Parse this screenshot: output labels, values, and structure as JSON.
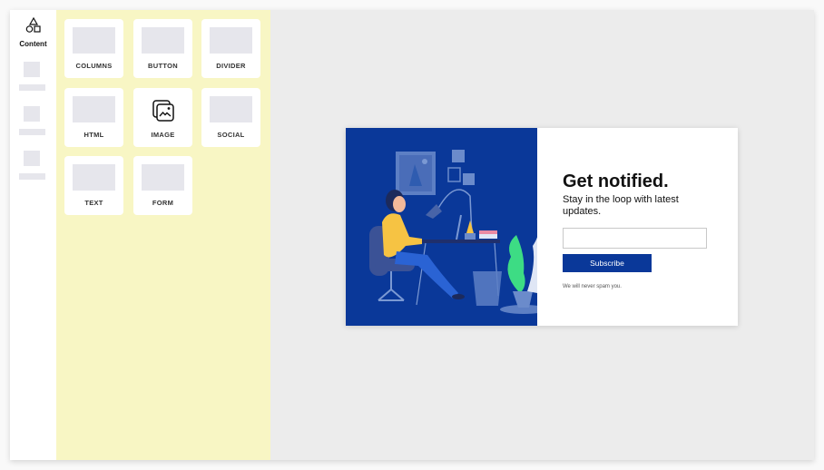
{
  "sidebar": {
    "active_item": {
      "icon": "shapes-icon",
      "label": "Content"
    },
    "placeholder_items": 3
  },
  "blocks_panel": {
    "tiles": [
      {
        "label": "COLUMNS",
        "icon": "placeholder"
      },
      {
        "label": "BUTTON",
        "icon": "placeholder"
      },
      {
        "label": "DIVIDER",
        "icon": "placeholder"
      },
      {
        "label": "HTML",
        "icon": "placeholder"
      },
      {
        "label": "IMAGE",
        "icon": "image-icon"
      },
      {
        "label": "SOCIAL",
        "icon": "placeholder"
      },
      {
        "label": "TEXT",
        "icon": "placeholder"
      },
      {
        "label": "FORM",
        "icon": "placeholder"
      }
    ]
  },
  "popup": {
    "title": "Get notified.",
    "subtitle": "Stay in the loop with latest updates.",
    "email_value": "",
    "email_placeholder": "",
    "button_label": "Subscribe",
    "note": "We will never spam you.",
    "illustration": "woman-working-at-desk-illustration",
    "colors": {
      "brand": "#0a3899",
      "panel": "#f8f6c4",
      "canvas": "#ececec"
    }
  }
}
